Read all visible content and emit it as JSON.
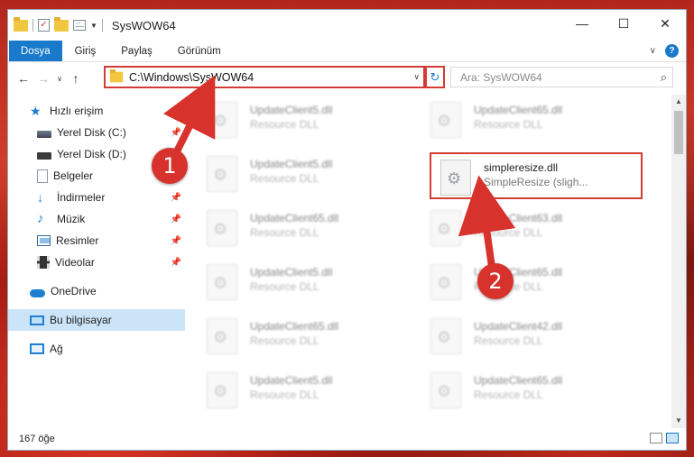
{
  "window": {
    "title": "SysWOW64"
  },
  "ribbon": {
    "tabs": [
      "Dosya",
      "Giriş",
      "Paylaş",
      "Görünüm"
    ]
  },
  "nav": {
    "address": "C:\\Windows\\SysWOW64",
    "search_placeholder": "Ara: SysWOW64"
  },
  "sidebar": {
    "items": [
      {
        "label": "Hızlı erişim",
        "icon": "star-icon"
      },
      {
        "label": "Yerel Disk (C:)",
        "icon": "disk-icon"
      },
      {
        "label": "Yerel Disk (D:)",
        "icon": "disk-icon"
      },
      {
        "label": "Belgeler",
        "icon": "documents-icon"
      },
      {
        "label": "İndirmeler",
        "icon": "download-icon"
      },
      {
        "label": "Müzik",
        "icon": "music-icon"
      },
      {
        "label": "Resimler",
        "icon": "pictures-icon"
      },
      {
        "label": "Videolar",
        "icon": "videos-icon"
      },
      {
        "label": "OneDrive",
        "icon": "cloud-icon"
      },
      {
        "label": "Bu bilgisayar",
        "icon": "computer-icon"
      },
      {
        "label": "Ağ",
        "icon": "network-icon"
      }
    ]
  },
  "files": {
    "left": [
      {
        "name": "UpdateClient5.dll",
        "desc": "Resource DLL"
      },
      {
        "name": "UpdateClient5.dll",
        "desc": "Resource DLL"
      },
      {
        "name": "UpdateClient65.dll",
        "desc": "Resource DLL"
      },
      {
        "name": "UpdateClient5.dll",
        "desc": "Resource DLL"
      },
      {
        "name": "UpdateClient65.dll",
        "desc": "Resource DLL"
      },
      {
        "name": "UpdateClient5.dll",
        "desc": "Resource DLL"
      }
    ],
    "right": [
      {
        "name": "UpdateClient65.dll",
        "desc": "Resource DLL"
      },
      {
        "name": "simpleresize.dll",
        "desc": "SimpleResize (sligh..."
      },
      {
        "name": "UpdateClient63.dll",
        "desc": "Resource DLL"
      },
      {
        "name": "UpdateClient65.dll",
        "desc": "Resource DLL"
      },
      {
        "name": "UpdateClient42.dll",
        "desc": "Resource DLL"
      },
      {
        "name": "UpdateClient65.dll",
        "desc": "Resource DLL"
      }
    ]
  },
  "status": {
    "count": "167 öğe"
  },
  "annotations": {
    "step1": "1",
    "step2": "2",
    "color": "#d8322c"
  }
}
